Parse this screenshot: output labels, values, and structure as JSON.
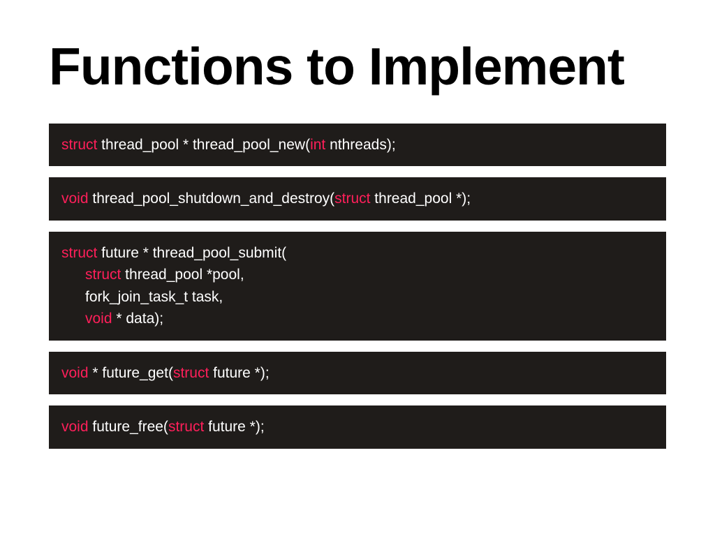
{
  "title": "Functions to Implement",
  "kw": {
    "struct": "struct",
    "int": "int",
    "void": "void"
  },
  "box1": {
    "t1": " thread_pool * thread_pool_new(",
    "t2": " nthreads);"
  },
  "box2": {
    "t1": " thread_pool_shutdown_and_destroy(",
    "t2": " thread_pool *);"
  },
  "box3": {
    "line1_after": " future * thread_pool_submit(",
    "line2_after": " thread_pool *pool,",
    "line3": "fork_join_task_t task,",
    "line4_after": " * data);"
  },
  "box4": {
    "t1": " * future_get(",
    "t2": " future *);"
  },
  "box5": {
    "t1": " future_free(",
    "t2": " future *);"
  }
}
